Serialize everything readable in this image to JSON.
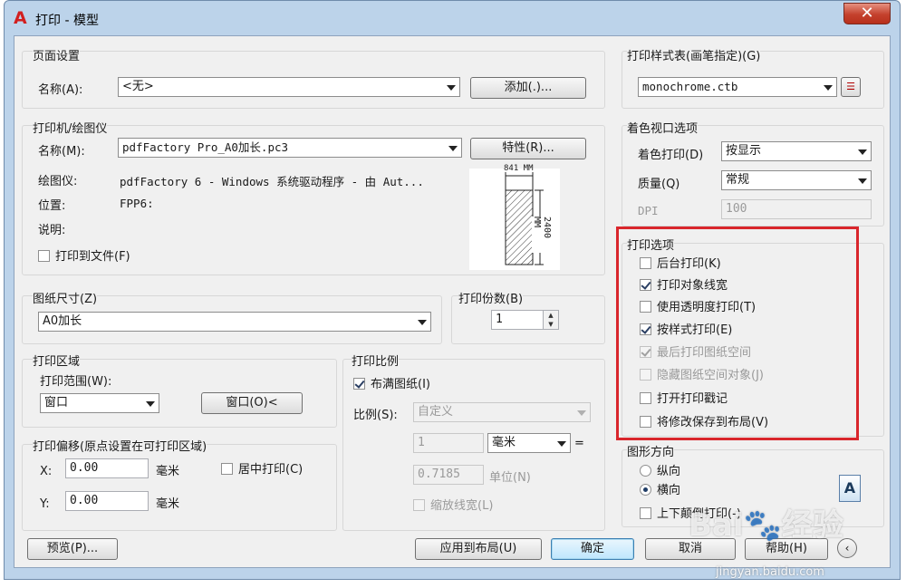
{
  "window": {
    "title": "打印 - 模型",
    "close_label": "✕"
  },
  "page_setup": {
    "group_title": "页面设置",
    "name_label": "名称(A):",
    "name_value": "<无>",
    "add_button": "添加(.)..."
  },
  "printer": {
    "group_title": "打印机/绘图仪",
    "name_label": "名称(M):",
    "name_value": "pdfFactory Pro_A0加长.pc3",
    "properties_button": "特性(R)...",
    "plotter_label": "绘图仪:",
    "plotter_value": "pdfFactory 6 - Windows 系统驱动程序 - 由 Aut...",
    "location_label": "位置:",
    "location_value": "FPP6:",
    "description_label": "说明:",
    "print_to_file": "打印到文件(F)",
    "preview_dim_top": "841 MM",
    "preview_dim_side": "2400 MM"
  },
  "paper_size": {
    "group_title": "图纸尺寸(Z)",
    "value": "A0加长"
  },
  "copies": {
    "group_title": "打印份数(B)",
    "value": "1"
  },
  "plot_area": {
    "group_title": "打印区域",
    "range_label": "打印范围(W):",
    "range_value": "窗口",
    "window_button": "窗口(O)<"
  },
  "plot_offset": {
    "group_title": "打印偏移(原点设置在可打印区域)",
    "x_label": "X:",
    "x_value": "0.00",
    "x_unit": "毫米",
    "y_label": "Y:",
    "y_value": "0.00",
    "y_unit": "毫米",
    "center_plot": "居中打印(C)"
  },
  "plot_scale": {
    "group_title": "打印比例",
    "fit_to_paper": "布满图纸(I)",
    "scale_label": "比例(S):",
    "scale_value": "自定义",
    "value1": "1",
    "unit_value": "毫米",
    "equals": "=",
    "value2": "0.7185",
    "unit_label": "单位(N)",
    "scale_lineweights": "缩放线宽(L)"
  },
  "plot_style_table": {
    "group_title": "打印样式表(画笔指定)(G)",
    "value": "monochrome.ctb"
  },
  "shaded_viewport": {
    "group_title": "着色视口选项",
    "shade_label": "着色打印(D)",
    "shade_value": "按显示",
    "quality_label": "质量(Q)",
    "quality_value": "常规",
    "dpi_label": "DPI",
    "dpi_value": "100"
  },
  "plot_options": {
    "group_title": "打印选项",
    "items": [
      {
        "label": "后台打印(K)"
      },
      {
        "label": "打印对象线宽"
      },
      {
        "label": "使用透明度打印(T)"
      },
      {
        "label": "按样式打印(E)"
      },
      {
        "label": "最后打印图纸空间"
      },
      {
        "label": "隐藏图纸空间对象(J)"
      },
      {
        "label": "打开打印戳记"
      },
      {
        "label": "将修改保存到布局(V)"
      }
    ]
  },
  "orientation": {
    "group_title": "图形方向",
    "portrait": "纵向",
    "landscape": "横向",
    "upside_down": "上下颠倒打印(-)",
    "preview_letter": "A"
  },
  "footer": {
    "preview": "预览(P)...",
    "apply_layout": "应用到布局(U)",
    "ok": "确定",
    "cancel": "取消",
    "help": "帮助(H)"
  },
  "watermark": {
    "brand": "Bai",
    "brand_tail": "经验",
    "url": "jingyan.baidu.com"
  },
  "colors": {
    "highlight_border": "#d9262c",
    "dialog_bg": "#f0f0f0",
    "frame": "#bcd3ea"
  }
}
